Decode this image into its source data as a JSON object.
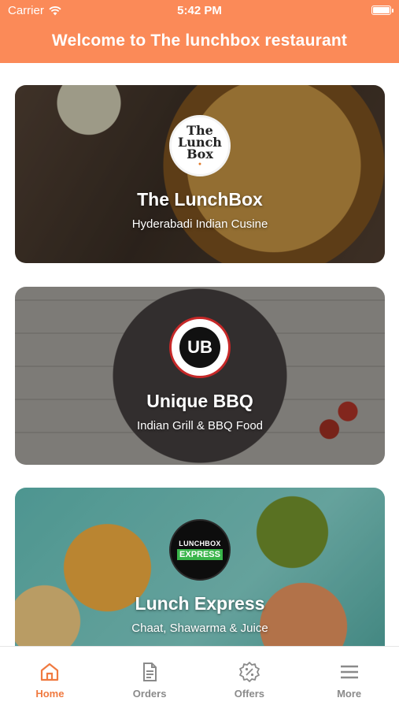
{
  "status_bar": {
    "carrier": "Carrier",
    "time": "5:42 PM"
  },
  "header": {
    "title": "Welcome to The lunchbox restaurant"
  },
  "colors": {
    "accent": "#fb8a58",
    "active_tab": "#f07a40",
    "inactive_tab": "#8a8a8a"
  },
  "restaurants": [
    {
      "name": "The LunchBox",
      "cuisine": "Hyderabadi Indian Cusine",
      "logo_text": "The Lunch Box"
    },
    {
      "name": "Unique BBQ",
      "cuisine": "Indian Grill & BBQ Food",
      "logo_text": "UB"
    },
    {
      "name": "Lunch Express",
      "cuisine": "Chaat, Shawarma & Juice",
      "logo_top": "LUNCHBOX",
      "logo_bottom": "EXPRESS"
    }
  ],
  "tabs": [
    {
      "label": "Home",
      "icon": "home-icon",
      "active": true
    },
    {
      "label": "Orders",
      "icon": "orders-icon",
      "active": false
    },
    {
      "label": "Offers",
      "icon": "offers-icon",
      "active": false
    },
    {
      "label": "More",
      "icon": "menu-icon",
      "active": false
    }
  ]
}
